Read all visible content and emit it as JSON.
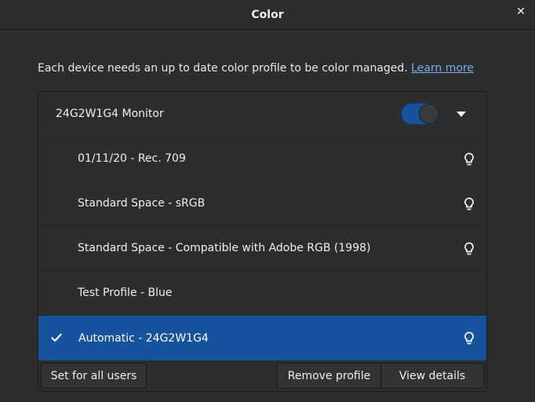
{
  "window": {
    "title": "Color"
  },
  "intro": {
    "text": "Each device needs an up to date color profile to be color managed.",
    "learn_more": "Learn more"
  },
  "device": {
    "name": "24G2W1G4 Monitor",
    "enabled": true,
    "expanded": true
  },
  "profiles": [
    {
      "label": "01/11/20 - Rec. 709",
      "has_bulb": true,
      "selected": false
    },
    {
      "label": "Standard Space - sRGB",
      "has_bulb": true,
      "selected": false
    },
    {
      "label": "Standard Space - Compatible with Adobe RGB (1998)",
      "has_bulb": true,
      "selected": false
    },
    {
      "label": "Test Profile - Blue",
      "has_bulb": false,
      "selected": false
    },
    {
      "label": "Automatic - 24G2W1G4",
      "has_bulb": true,
      "selected": true
    }
  ],
  "actions": {
    "set_for_all": "Set for all users",
    "remove_profile": "Remove profile",
    "view_details": "View details"
  },
  "colors": {
    "accent": "#15539e",
    "link": "#78aeed",
    "background": "#2d2d2d"
  },
  "icons": {
    "close": "close-icon",
    "dropdown": "chevron-down-icon",
    "bulb": "lightbulb-icon",
    "check": "checkmark-icon"
  }
}
